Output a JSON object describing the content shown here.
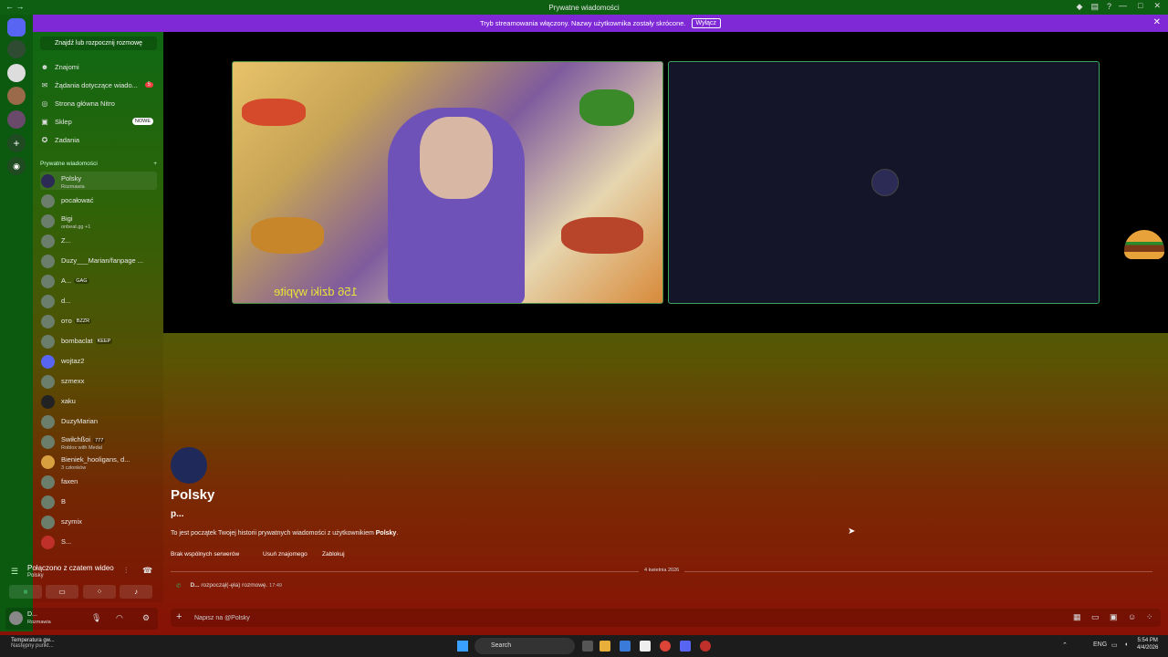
{
  "window": {
    "title": "Prywatne wiadomości"
  },
  "banner": {
    "text": "Tryb streamowania włączony. Nazwy użytkownika zostały skrócone.",
    "button": "Wyłącz"
  },
  "sidebar": {
    "find": "Znajdź lub rozpocznij rozmowę",
    "nav": [
      {
        "label": "Znajomi",
        "icon": "friends-icon"
      },
      {
        "label": "Żądania dotyczące wiado...",
        "icon": "mail-icon",
        "badge": "5"
      },
      {
        "label": "Strona główna Nitro",
        "icon": "nitro-icon"
      },
      {
        "label": "Sklep",
        "icon": "shop-icon",
        "new": "NOWE"
      },
      {
        "label": "Zadania",
        "icon": "quests-icon"
      }
    ],
    "dm_header": "Prywatne wiadomości",
    "dm_add": "+",
    "dms": [
      {
        "name": "Polsky",
        "sub": "Rozmawia"
      },
      {
        "name": "pocałować",
        "sub": ""
      },
      {
        "name": "Bigi",
        "sub": "onbeat.gg +1"
      },
      {
        "name": "Z...",
        "sub": ""
      },
      {
        "name": "Duzy___Marian/fanpage ...",
        "sub": ""
      },
      {
        "name": "A...",
        "sub": "",
        "tag": "GAG"
      },
      {
        "name": "d...",
        "sub": ""
      },
      {
        "name": "ᴏᴛᴏ",
        "sub": "",
        "tag": "BZZR"
      },
      {
        "name": "bombaclat",
        "sub": "",
        "tag": "KEEP"
      },
      {
        "name": "wojtaz2",
        "sub": ""
      },
      {
        "name": "szmexx",
        "sub": ""
      },
      {
        "name": "xaku",
        "sub": ""
      },
      {
        "name": "DuzyMarian",
        "sub": ""
      },
      {
        "name": "Swiłchßoi",
        "sub": "Roblox with Medal",
        "tag": "777"
      },
      {
        "name": "Bieniek_hooligans, d...",
        "sub": "3 członków"
      },
      {
        "name": "faxen",
        "sub": ""
      },
      {
        "name": "B",
        "sub": ""
      },
      {
        "name": "szymix",
        "sub": ""
      },
      {
        "name": "S...",
        "sub": ""
      }
    ]
  },
  "voice": {
    "status": "Połączono z czatem wideo",
    "channel": "Polsky"
  },
  "user": {
    "name": "D...",
    "status": "Rozmawia"
  },
  "stage": {
    "caption": "156 dziki wypite"
  },
  "profile": {
    "display_name": "Polsky",
    "username": "p...",
    "intro_prefix": "To jest początek Twojej historii prywatnych wiadomości z użytkownikiem ",
    "intro_name": "Polsky",
    "intro_suffix": ".",
    "buttons": [
      "Brak wspólnych serwerów",
      "Usuń znajomego",
      "Zablokuj"
    ]
  },
  "chat": {
    "date_divider": "4 kwietnia 2026",
    "system_user": "D...",
    "system_text": "rozpoczął(-ęła) rozmowę.",
    "system_time": "17:49"
  },
  "composer": {
    "placeholder": "Napisz na @Polsky"
  },
  "taskbar": {
    "weather_title": "Temperatura gw...",
    "weather_sub": "Następny punkt...",
    "search": "Search",
    "lang": "ENG",
    "time": "5:54 PM",
    "date": "4/4/2026"
  }
}
